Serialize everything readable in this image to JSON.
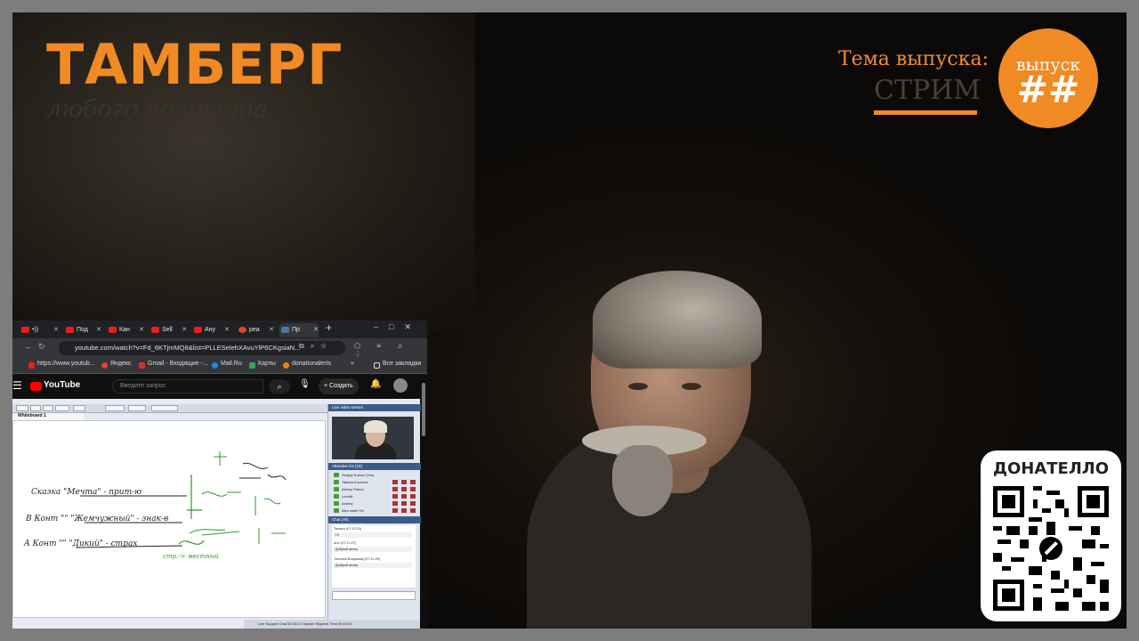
{
  "overlay": {
    "brand_title": "ТАМБЕРГ",
    "brand_subtitle": "любого возраста",
    "topic_label": "Тема выпуска:",
    "topic_value": "СТРИМ",
    "episode_label": "выпуск",
    "episode_number": "##",
    "donate_title": "ДОНАТЕЛЛО",
    "accent_color": "#f08a24"
  },
  "browser": {
    "tabs": [
      {
        "label": "•))"
      },
      {
        "label": "Под"
      },
      {
        "label": "Кан"
      },
      {
        "label": "Sell"
      },
      {
        "label": "Ану"
      },
      {
        "label": "реа"
      },
      {
        "label": "Пр"
      }
    ],
    "url": "youtube.com/watch?v=Fd_6KTjmMQ8&list=PLLESelehXAvuYlP6CKgsiaN...",
    "bookmarks": [
      {
        "label": "https://www.youtub...",
        "color": "#e62117"
      },
      {
        "label": "Яндекс",
        "color": "#e0442c"
      },
      {
        "label": "Gmail - Входящие -...",
        "color": "#d93025"
      },
      {
        "label": "Mail.Ru",
        "color": "#168de2"
      },
      {
        "label": "Карты",
        "color": "#34a853"
      },
      {
        "label": "donationalerts",
        "color": "#f57d07"
      }
    ],
    "bookmarks_more": "»",
    "all_bookmarks": "Все закладки"
  },
  "youtube": {
    "logo_text": "YouTube",
    "search_placeholder": "Введите запрос",
    "create_label": "Создать"
  },
  "webinar": {
    "whiteboard_tab": "Whiteboard 1",
    "camera_header": "Live video stream",
    "attendees_header": "Attendee list (10)",
    "attendees": [
      {
        "name": "Sergey Kozlov (You)"
      },
      {
        "name": "Tatiana Kuzmina"
      },
      {
        "name": "Alexey Petrov"
      },
      {
        "name": "Leonid"
      },
      {
        "name": "Andrey"
      },
      {
        "name": "Alex smith Tel"
      }
    ],
    "chat_header": "Chat (All)",
    "chat_messages": [
      {
        "author": "Tamara",
        "time": "(07:12:23)",
        "text": "Hi"
      },
      {
        "author": "Ann",
        "time": "(07:12:27)",
        "text": "Добрый вечер"
      },
      {
        "author": "Тальяна Владимир",
        "time": "(07:12:29)",
        "text": "Добрый вечер"
      }
    ],
    "status_text": "Live Support Chat   00:13:23   Прочее   Elapsed Time 00:19:03"
  },
  "whiteboard_text": {
    "line1": "Сказка \"Мечта\" - прит-ю",
    "line2": "В Конт \"\" \"Жемчужный\" - знак-в",
    "line3": "А Конт \"\" \"Дикий\" - страх",
    "note": "стр.-> местный"
  }
}
